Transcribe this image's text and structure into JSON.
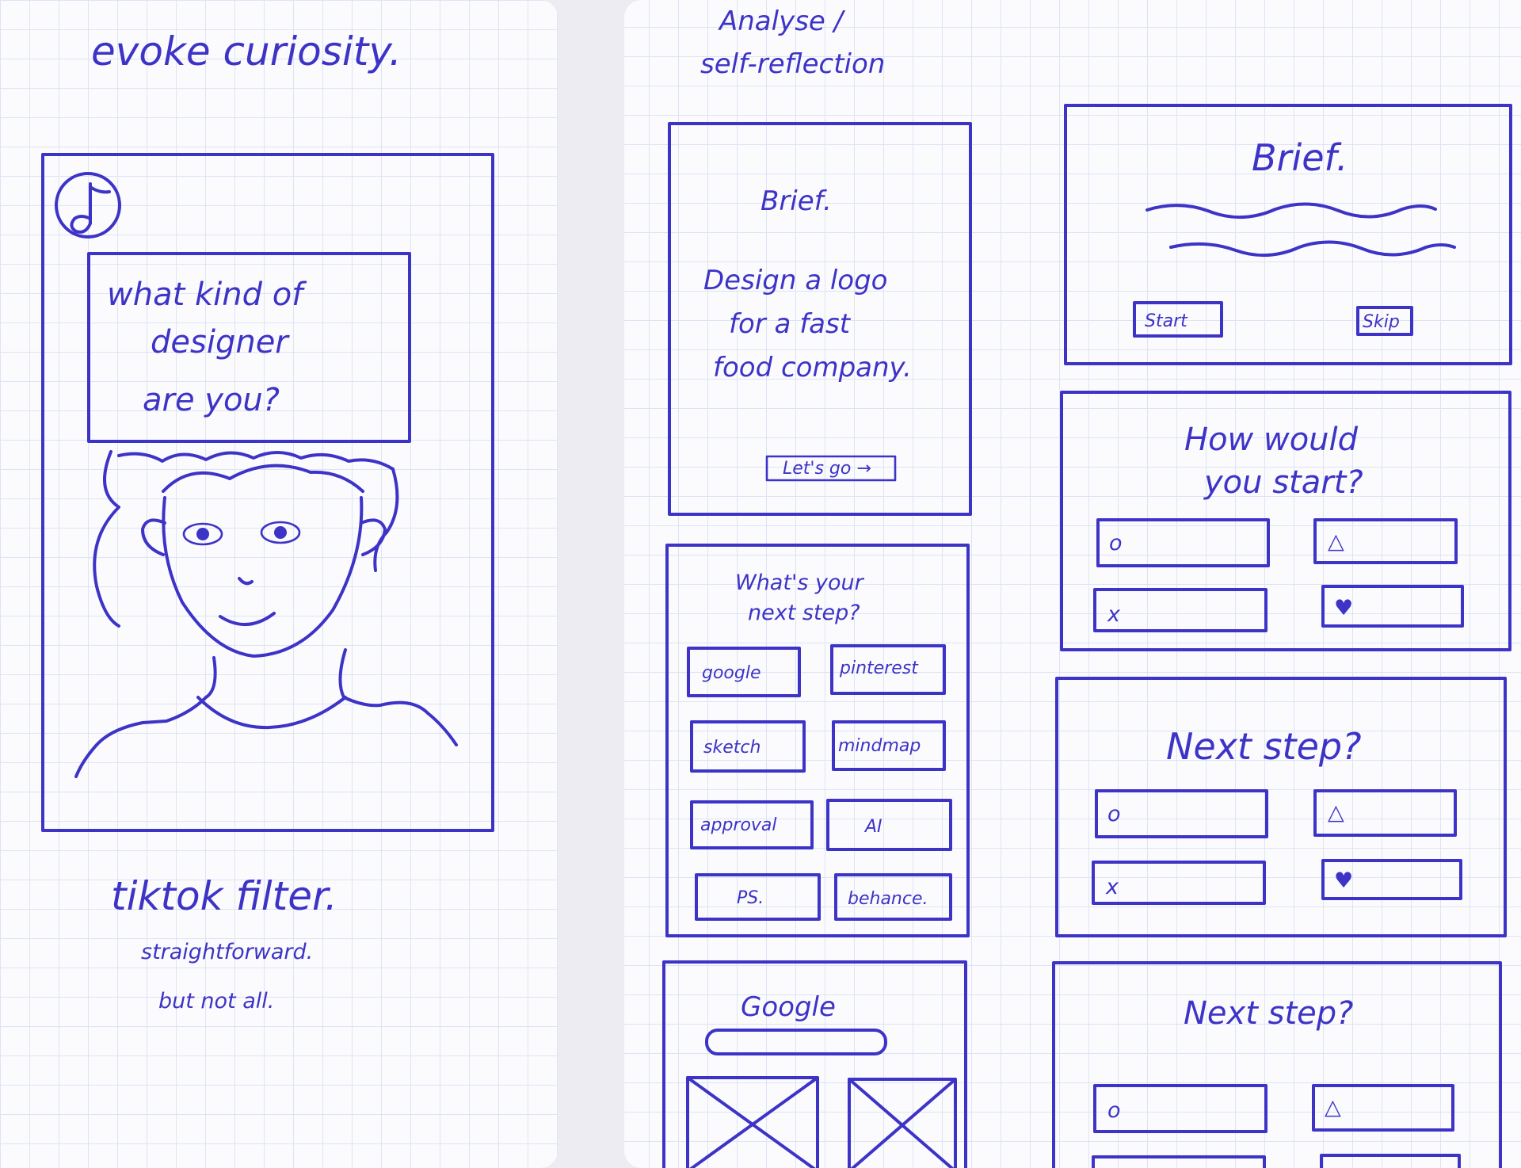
{
  "left_panel": {
    "heading": "evoke curiosity.",
    "question_lines": [
      "what kind of",
      "designer",
      "are you?"
    ],
    "caption": "tiktok filter.",
    "note_lines": [
      "straightforward.",
      "but not all."
    ],
    "icon": "tiktok-logo"
  },
  "right_panel": {
    "heading_lines": [
      "Analyse /",
      "self-reflection"
    ],
    "brief_card": {
      "title": "Brief.",
      "body_lines": [
        "Design a logo",
        "for a fast",
        "food company."
      ],
      "button": "Let's go →"
    },
    "brief_card_2": {
      "title": "Brief.",
      "buttons": [
        "Start",
        "Skip"
      ]
    },
    "how_card": {
      "title_lines": [
        "How would",
        "you start?"
      ],
      "options": [
        "o",
        "△",
        "x",
        "♥"
      ]
    },
    "next_step_card": {
      "title_lines": [
        "What's your",
        "next step?"
      ],
      "options": [
        "google",
        "pinterest",
        "sketch",
        "mindmap",
        "approval",
        "AI",
        "PS.",
        "behance."
      ]
    },
    "next_step_card_2": {
      "title": "Next step?",
      "options": [
        "o",
        "△",
        "x",
        "♥"
      ]
    },
    "google_card": {
      "title": "Google"
    },
    "next_step_card_3": {
      "title": "Next step?",
      "options": [
        "o",
        "△"
      ]
    }
  }
}
